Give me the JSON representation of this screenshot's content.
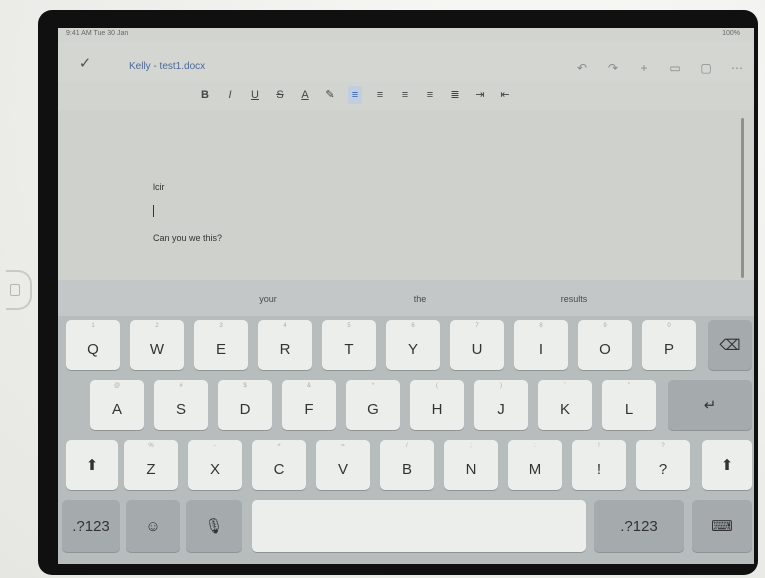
{
  "status_bar": {
    "left": "9:41 AM  Tue 30 Jan",
    "right": "100%"
  },
  "title_bar": {
    "done_icon": "checkmark-icon",
    "doc_title": "Kelly - test1.docx",
    "icons": [
      "undo-icon",
      "redo-icon",
      "add-icon",
      "comment-icon",
      "layout-icon",
      "more-icon"
    ]
  },
  "format_bar": {
    "bold": "B",
    "italic": "I",
    "underline": "U",
    "strike": "S",
    "text_color": "A",
    "highlight": "✎",
    "align_left": "≡",
    "align_center": "≡",
    "align_right": "≡",
    "justify": "≡",
    "list": "≣",
    "indent_increase": "⇥",
    "indent_decrease": "⇤",
    "active_color": "#2f5fb3"
  },
  "document": {
    "line1": "lcir",
    "line3": "Can  you we this?"
  },
  "keyboard": {
    "suggestions": [
      "your",
      "the",
      "results"
    ],
    "row1": [
      {
        "hint": "1",
        "label": "Q"
      },
      {
        "hint": "2",
        "label": "W"
      },
      {
        "hint": "3",
        "label": "E"
      },
      {
        "hint": "4",
        "label": "R"
      },
      {
        "hint": "5",
        "label": "T"
      },
      {
        "hint": "6",
        "label": "Y"
      },
      {
        "hint": "7",
        "label": "U"
      },
      {
        "hint": "8",
        "label": "I"
      },
      {
        "hint": "9",
        "label": "O"
      },
      {
        "hint": "0",
        "label": "P"
      }
    ],
    "row2": [
      {
        "hint": "@",
        "label": "A"
      },
      {
        "hint": "#",
        "label": "S"
      },
      {
        "hint": "$",
        "label": "D"
      },
      {
        "hint": "&",
        "label": "F"
      },
      {
        "hint": "*",
        "label": "G"
      },
      {
        "hint": "(",
        "label": "H"
      },
      {
        "hint": ")",
        "label": "J"
      },
      {
        "hint": "'",
        "label": "K"
      },
      {
        "hint": "\"",
        "label": "L"
      }
    ],
    "row3": [
      {
        "hint": "%",
        "label": "Z"
      },
      {
        "hint": "-",
        "label": "X"
      },
      {
        "hint": "+",
        "label": "C"
      },
      {
        "hint": "=",
        "label": "V"
      },
      {
        "hint": "/",
        "label": "B"
      },
      {
        "hint": ";",
        "label": "N"
      },
      {
        "hint": ":",
        "label": "M"
      },
      {
        "hint": "!",
        "label": "!"
      },
      {
        "hint": "?",
        "label": "?"
      }
    ],
    "delete_label": "⌫",
    "return_label": "↵",
    "shift_label": "⬆",
    "numbers_label": ".?123",
    "numbers_label_right": ".?123",
    "emoji_label": "☺",
    "mic_label": "🎙",
    "hide_label": "⌨"
  }
}
